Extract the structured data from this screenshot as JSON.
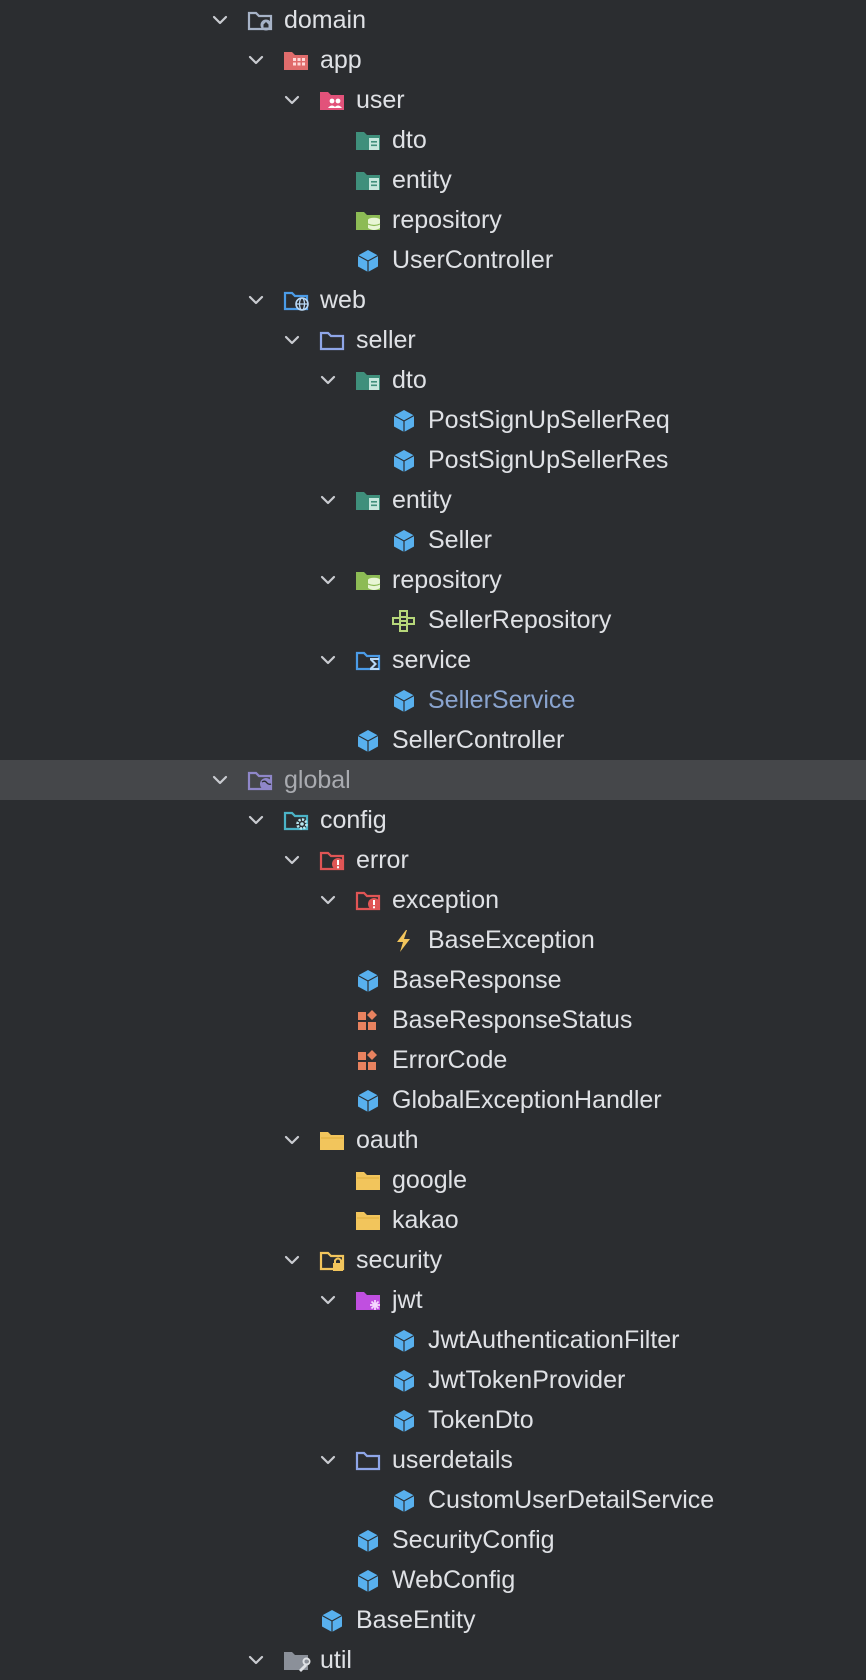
{
  "colors": {
    "background": "#2b2d30",
    "selected_row": "#45474a",
    "text": "#dfe1e5",
    "selected_text": "#a9abb0",
    "open_file_text": "#8aa4cf"
  },
  "tree": [
    {
      "label": "domain",
      "depth": 0,
      "expanded": true,
      "icon": "package-root-folder-icon",
      "name": "domain"
    },
    {
      "label": "app",
      "depth": 1,
      "expanded": true,
      "icon": "app-module-folder-icon",
      "name": "app"
    },
    {
      "label": "user",
      "depth": 2,
      "expanded": true,
      "icon": "user-folder-icon",
      "name": "user"
    },
    {
      "label": "dto",
      "depth": 3,
      "expanded": null,
      "icon": "dto-folder-icon",
      "name": "user-dto"
    },
    {
      "label": "entity",
      "depth": 3,
      "expanded": null,
      "icon": "entity-folder-icon",
      "name": "user-entity"
    },
    {
      "label": "repository",
      "depth": 3,
      "expanded": null,
      "icon": "repository-folder-icon",
      "name": "user-repository"
    },
    {
      "label": "UserController",
      "depth": 3,
      "expanded": null,
      "icon": "class-icon",
      "name": "user-controller"
    },
    {
      "label": "web",
      "depth": 1,
      "expanded": true,
      "icon": "web-folder-icon",
      "name": "web"
    },
    {
      "label": "seller",
      "depth": 2,
      "expanded": true,
      "icon": "folder-icon",
      "name": "seller"
    },
    {
      "label": "dto",
      "depth": 3,
      "expanded": true,
      "icon": "dto-folder-icon",
      "name": "seller-dto"
    },
    {
      "label": "PostSignUpSellerReq",
      "depth": 4,
      "expanded": null,
      "icon": "class-icon",
      "name": "post-sign-up-seller-req"
    },
    {
      "label": "PostSignUpSellerRes",
      "depth": 4,
      "expanded": null,
      "icon": "class-icon",
      "name": "post-sign-up-seller-res"
    },
    {
      "label": "entity",
      "depth": 3,
      "expanded": true,
      "icon": "entity-folder-icon",
      "name": "seller-entity"
    },
    {
      "label": "Seller",
      "depth": 4,
      "expanded": null,
      "icon": "class-icon",
      "name": "seller-class"
    },
    {
      "label": "repository",
      "depth": 3,
      "expanded": true,
      "icon": "repository-folder-icon",
      "name": "seller-repository"
    },
    {
      "label": "SellerRepository",
      "depth": 4,
      "expanded": null,
      "icon": "interface-icon",
      "name": "seller-repository-interface"
    },
    {
      "label": "service",
      "depth": 3,
      "expanded": true,
      "icon": "service-folder-icon",
      "name": "seller-service-folder"
    },
    {
      "label": "SellerService",
      "depth": 4,
      "expanded": null,
      "icon": "class-icon",
      "name": "seller-service",
      "style": "link"
    },
    {
      "label": "SellerController",
      "depth": 3,
      "expanded": null,
      "icon": "class-icon",
      "name": "seller-controller"
    },
    {
      "label": "global",
      "depth": 0,
      "expanded": true,
      "icon": "global-folder-icon",
      "name": "global",
      "selected": true
    },
    {
      "label": "config",
      "depth": 1,
      "expanded": true,
      "icon": "config-folder-icon",
      "name": "config"
    },
    {
      "label": "error",
      "depth": 2,
      "expanded": true,
      "icon": "error-folder-icon",
      "name": "error"
    },
    {
      "label": "exception",
      "depth": 3,
      "expanded": true,
      "icon": "error-folder-icon",
      "name": "exception"
    },
    {
      "label": "BaseException",
      "depth": 4,
      "expanded": null,
      "icon": "exception-icon",
      "name": "base-exception"
    },
    {
      "label": "BaseResponse",
      "depth": 3,
      "expanded": null,
      "icon": "class-icon",
      "name": "base-response"
    },
    {
      "label": "BaseResponseStatus",
      "depth": 3,
      "expanded": null,
      "icon": "enum-icon",
      "name": "base-response-status"
    },
    {
      "label": "ErrorCode",
      "depth": 3,
      "expanded": null,
      "icon": "enum-icon",
      "name": "error-code"
    },
    {
      "label": "GlobalExceptionHandler",
      "depth": 3,
      "expanded": null,
      "icon": "class-icon",
      "name": "global-exception-handler"
    },
    {
      "label": "oauth",
      "depth": 2,
      "expanded": true,
      "icon": "yellow-folder-icon",
      "name": "oauth"
    },
    {
      "label": "google",
      "depth": 3,
      "expanded": null,
      "icon": "yellow-folder-icon",
      "name": "google"
    },
    {
      "label": "kakao",
      "depth": 3,
      "expanded": null,
      "icon": "yellow-folder-icon",
      "name": "kakao"
    },
    {
      "label": "security",
      "depth": 2,
      "expanded": true,
      "icon": "security-folder-icon",
      "name": "security"
    },
    {
      "label": "jwt",
      "depth": 3,
      "expanded": true,
      "icon": "jwt-folder-icon",
      "name": "jwt"
    },
    {
      "label": "JwtAuthenticationFilter",
      "depth": 4,
      "expanded": null,
      "icon": "class-icon",
      "name": "jwt-authentication-filter"
    },
    {
      "label": "JwtTokenProvider",
      "depth": 4,
      "expanded": null,
      "icon": "class-icon",
      "name": "jwt-token-provider"
    },
    {
      "label": "TokenDto",
      "depth": 4,
      "expanded": null,
      "icon": "class-icon",
      "name": "token-dto"
    },
    {
      "label": "userdetails",
      "depth": 3,
      "expanded": true,
      "icon": "folder-icon",
      "name": "userdetails"
    },
    {
      "label": "CustomUserDetailService",
      "depth": 4,
      "expanded": null,
      "icon": "class-icon",
      "name": "custom-user-detail-service"
    },
    {
      "label": "SecurityConfig",
      "depth": 3,
      "expanded": null,
      "icon": "class-icon",
      "name": "security-config"
    },
    {
      "label": "WebConfig",
      "depth": 3,
      "expanded": null,
      "icon": "class-icon",
      "name": "web-config"
    },
    {
      "label": "BaseEntity",
      "depth": 2,
      "expanded": null,
      "icon": "class-icon",
      "name": "base-entity"
    },
    {
      "label": "util",
      "depth": 1,
      "expanded": true,
      "icon": "util-folder-icon",
      "name": "util"
    }
  ]
}
